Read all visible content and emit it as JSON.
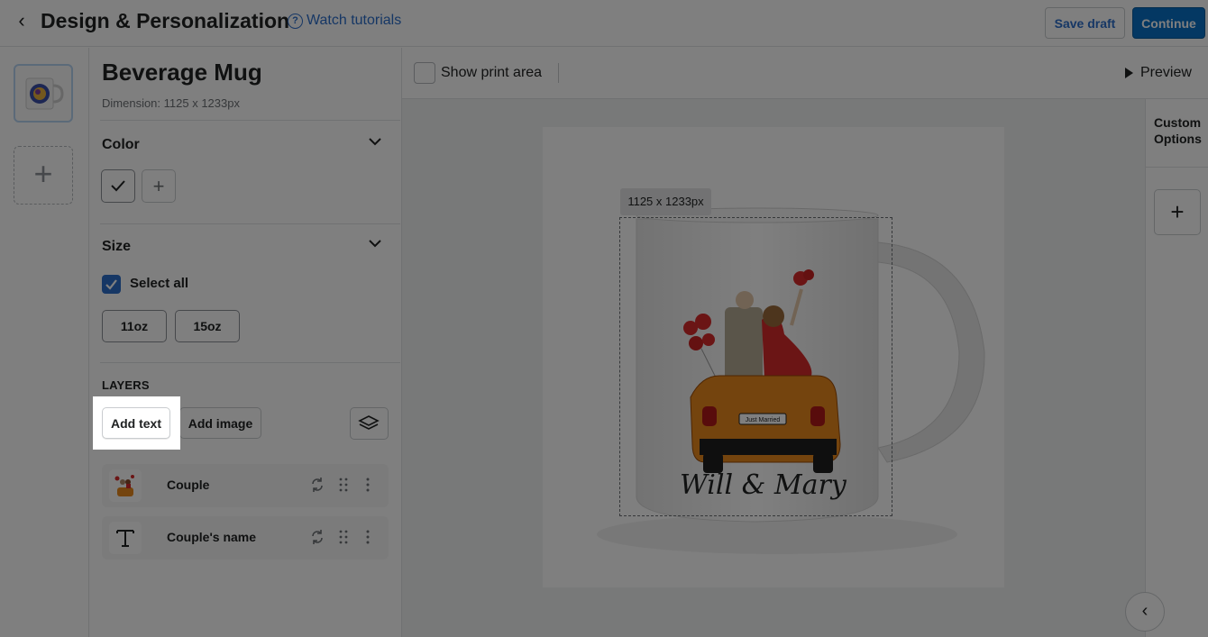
{
  "header": {
    "title": "Design & Personalization",
    "tutorial_label": "Watch tutorials",
    "save_draft_label": "Save draft",
    "continue_label": "Continue"
  },
  "product": {
    "name": "Beverage Mug",
    "dimension": "Dimension: 1125 x 1233px"
  },
  "color_section": {
    "title": "Color"
  },
  "size_section": {
    "title": "Size",
    "select_all_label": "Select all",
    "select_all_checked": true,
    "sizes": [
      "11oz",
      "15oz"
    ]
  },
  "layers_section": {
    "title": "LAYERS",
    "add_text_label": "Add text",
    "add_image_label": "Add image",
    "items": [
      {
        "name": "Couple",
        "icon": "image-thumbnail"
      },
      {
        "name": "Couple's name",
        "icon": "text-icon"
      }
    ]
  },
  "toolbar": {
    "show_print_area_label": "Show print area",
    "show_print_area_checked": false,
    "preview_label": "Preview"
  },
  "canvas": {
    "dimension_tag": "1125 x 1233px",
    "mug_text": "Will & Mary",
    "plate_text": "Just Married"
  },
  "options_panel": {
    "title": "Custom Options"
  },
  "colors": {
    "accent": "#2c6ecb",
    "primary_button": "#0870c6",
    "car_orange": "#e8891c",
    "dress_red": "#d62b2b"
  }
}
